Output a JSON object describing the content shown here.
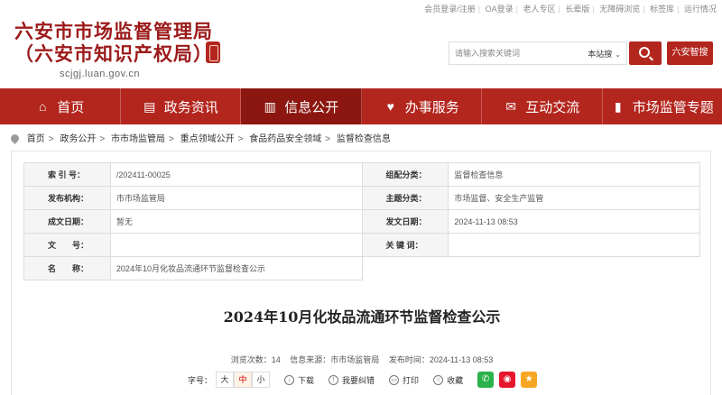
{
  "header": {
    "top_links": [
      "会员登录/注册",
      "OA登录",
      "老人专区",
      "长辈版",
      "无障碍浏览",
      "标签库",
      "运行情况"
    ],
    "title_line1": "六安市市场监督管理局",
    "title_line2": "（六安市知识产权局）",
    "domain": "scjgj.luan.gov.cn",
    "search": {
      "placeholder": "请输入搜索关键词",
      "scope": "本站搜"
    },
    "region_button": "六安智搜"
  },
  "nav": [
    {
      "label": "首页",
      "icon": "home-icon",
      "glyph": "⌂"
    },
    {
      "label": "政务资讯",
      "icon": "document-icon",
      "glyph": "▤"
    },
    {
      "label": "信息公开",
      "icon": "book-icon",
      "glyph": "▥",
      "active": true
    },
    {
      "label": "办事服务",
      "icon": "heart-icon",
      "glyph": "♥"
    },
    {
      "label": "互动交流",
      "icon": "chat-icon",
      "glyph": "✉"
    },
    {
      "label": "市场监管专题",
      "icon": "bookmark-icon",
      "glyph": "▮"
    }
  ],
  "breadcrumb": [
    "首页",
    "政务公开",
    "市市场监管局",
    "重点领域公开",
    "食品药品安全领域",
    "监督检查信息"
  ],
  "meta": {
    "index_label": "索 引 号：",
    "index_value": "/202411-00025",
    "category_label": "组配分类：",
    "category_value": "监督检查信息",
    "publisher_label": "发布机构：",
    "publisher_value": "市市场监管局",
    "topic_label": "主题分类：",
    "topic_value": "市场监督、安全生产监管",
    "created_label": "成文日期：",
    "created_value": "暂无",
    "published_label": "发文日期：",
    "published_value": "2024-11-13 08:53",
    "docno_label": "文　　号：",
    "docno_value": "",
    "keywords_label": "关 键 词：",
    "keywords_value": "",
    "name_label": "名　　称：",
    "name_value": "2024年10月化妆品流通环节监督检查公示"
  },
  "article": {
    "title": "2024年10月化妆品流通环节监督检查公示",
    "views": "浏览次数：14",
    "source": "信息来源：市市场监管局",
    "time": "发布时间：2024-11-13 08:53"
  },
  "tools": {
    "font_label": "字号：",
    "font_large": "大",
    "font_medium": "中",
    "font_small": "小",
    "download": "下载",
    "report_error": "我要纠错",
    "print": "打印",
    "collect": "收藏"
  },
  "colors": {
    "brand_red": "#b3261e",
    "nav_active": "#8c1710"
  }
}
